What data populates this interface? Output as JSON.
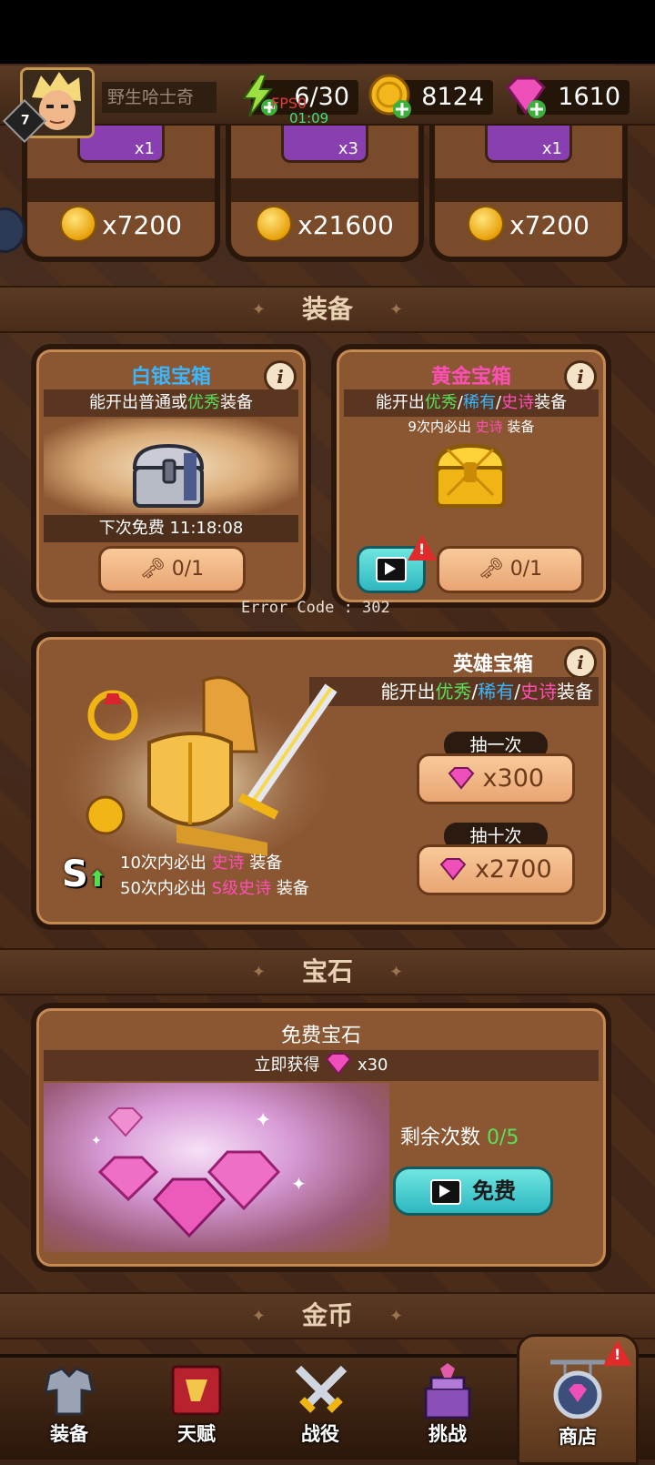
{
  "header": {
    "level": "7",
    "player_name": "野生哈士奇",
    "energy": "6/30",
    "coins": "8124",
    "gems": "1610",
    "fps": "FPS0",
    "timer": "01:09"
  },
  "top_offers": [
    {
      "qty": "x1",
      "price": "x7200"
    },
    {
      "qty": "x3",
      "price": "x21600"
    },
    {
      "qty": "x1",
      "price": "x7200"
    }
  ],
  "sections": {
    "equipment": "装备",
    "gems": "宝石",
    "coins": "金币"
  },
  "silver_chest": {
    "title": "白银宝箱",
    "desc_prefix": "能开出普通或",
    "desc_good": "优秀",
    "desc_suffix": "装备",
    "next_free_label": "下次免费",
    "next_free_time": "11:18:08",
    "keys": "0/1"
  },
  "gold_chest": {
    "title": "黄金宝箱",
    "desc_prefix": "能开出",
    "desc_good": "优秀",
    "sep1": "/",
    "desc_rare": "稀有",
    "sep2": "/",
    "desc_epic": "史诗",
    "desc_suffix": "装备",
    "guarantee_prefix": "9次内必出",
    "guarantee_epic": "史诗",
    "guarantee_suffix": "装备",
    "keys": "0/1"
  },
  "error_text": "Error Code : 302",
  "hero_chest": {
    "title": "英雄宝箱",
    "desc_prefix": "能开出",
    "desc_good": "优秀",
    "sep1": "/",
    "desc_rare": "稀有",
    "sep2": "/",
    "desc_epic": "史诗",
    "desc_suffix": "装备",
    "draw_one_label": "抽一次",
    "draw_one_price": "x300",
    "draw_ten_label": "抽十次",
    "draw_ten_price": "x2700",
    "g1_count": "10",
    "g1_mid": "次内必出",
    "g1_epic": "史诗",
    "g1_suffix": "装备",
    "g2_count": "50",
    "g2_mid": "次内必出",
    "g2_epic": "S级史诗",
    "g2_suffix": "装备",
    "s_badge": "S"
  },
  "free_gems": {
    "title": "免费宝石",
    "reward_label": "立即获得",
    "reward_qty": "x30",
    "remaining_label": "剩余次数",
    "remaining_value": "0/5",
    "free_button": "免费"
  },
  "nav": [
    {
      "label": "装备",
      "icon": "armor-icon"
    },
    {
      "label": "天赋",
      "icon": "talent-book-icon"
    },
    {
      "label": "战役",
      "icon": "crossed-swords-icon"
    },
    {
      "label": "挑战",
      "icon": "dragon-castle-icon"
    },
    {
      "label": "商店",
      "icon": "shop-sign-icon"
    }
  ],
  "colors": {
    "good": "#59e05a",
    "rare": "#3ab6ff",
    "epic": "#ff4fb6",
    "panel": "#8b5632"
  }
}
